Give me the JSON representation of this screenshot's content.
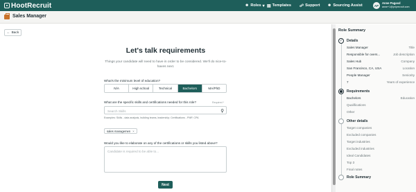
{
  "app": {
    "logo": "HootRecruit",
    "nav": [
      {
        "label": "Roles",
        "icon": "user-group-icon"
      },
      {
        "label": "Templates",
        "icon": "template-icon"
      },
      {
        "label": "Support",
        "icon": "support-icon"
      },
      {
        "label": "Sourcing Assist",
        "icon": "users-icon"
      }
    ],
    "user": {
      "initials": "AP",
      "name": "Anne Pagasd",
      "email": "anne+1@priprecruit.com"
    }
  },
  "page": {
    "title": "Sales Manager",
    "back_label": "Back"
  },
  "form": {
    "heading": "Let's talk requirements",
    "subheading": "Things your candidate will need to have in order to be considered. We'll do nice-to-haves next.",
    "education_question": "What's the minimum level of education?",
    "education_options": [
      "N/A",
      "High school",
      "Technical",
      "Bachelors",
      "MA/PhD"
    ],
    "education_selected": "Bachelors",
    "skills_question": "What are the specific skills and certifications needed for this role?",
    "required_label": "Required *",
    "skills_placeholder": "Search Skills",
    "skills_examples": "Examples: Skills - data analysis, building teams, leadership; Certifications - PMP, CPA",
    "selected_skill": "sales managemen",
    "elaborate_question": "Would you like to elaborate on any of the certifications or skills you listed above?",
    "elaborate_placeholder": "Candidate is required to be able to...",
    "next_label": "Next"
  },
  "summary": {
    "title": "Role Summary",
    "sections": [
      {
        "label": "Details",
        "state": "done",
        "rows": [
          {
            "text": "Sales Manager",
            "value": "Title"
          },
          {
            "text": "Responsible for overs...",
            "value": "Job description"
          },
          {
            "text": "Sales Hub",
            "value": "Company"
          },
          {
            "text": "San Francisco, CA, USA",
            "value": "Location"
          },
          {
            "text": "People Manager",
            "value": "Seniority"
          },
          {
            "text": "7",
            "value": "Years of experience"
          }
        ]
      },
      {
        "label": "Requirements",
        "state": "active",
        "rows": [
          {
            "text": "Bachelors",
            "value": "Education"
          },
          {
            "text": "Qualifications",
            "value": ""
          },
          {
            "text": "Other",
            "value": ""
          }
        ]
      },
      {
        "label": "Other details",
        "state": "future",
        "rows": [
          {
            "text": "Target companies",
            "value": ""
          },
          {
            "text": "Excluded companies",
            "value": ""
          },
          {
            "text": "Target industries",
            "value": ""
          },
          {
            "text": "Excluded industries",
            "value": ""
          },
          {
            "text": "Ideal Candidates",
            "value": ""
          },
          {
            "text": "Top 3",
            "value": ""
          },
          {
            "text": "Final notes",
            "value": ""
          }
        ]
      },
      {
        "label": "Role Summary",
        "state": "future",
        "rows": []
      }
    ]
  },
  "colors": {
    "brand": "#1e5e5a",
    "selected": "#1e5e5a"
  }
}
